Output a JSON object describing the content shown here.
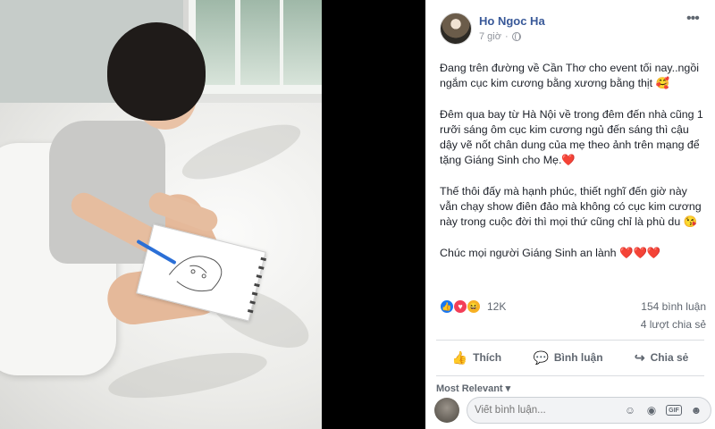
{
  "post": {
    "author": "Ho Ngoc Ha",
    "time": "7 giờ",
    "paragraphs": [
      "Đang trên đường về Cần Thơ cho event tối nay..ngồi ngắm cục kim cương bằng xương bằng thịt 🥰",
      "Đêm qua bay từ Hà Nội về trong đêm đến nhà cũng 1 rưỡi sáng ôm cục kim cương ngủ đến sáng thì cậu dậy vẽ nốt chân dung của mẹ theo ảnh trên mạng để tặng Giáng Sinh cho Mẹ.",
      "Thế thôi đấy mà hạnh phúc, thiết nghĩ đến giờ này vẫn chạy show điên đảo mà không có cục kim cương này trong cuộc đời thì mọi thứ cũng chỉ là phù du 😘",
      "Chúc mọi người Giáng Sinh an lành"
    ],
    "hearts_p2": "❤️",
    "hearts_p4": "❤️❤️❤️"
  },
  "stats": {
    "reaction_count": "12K",
    "comments": "154 bình luận",
    "shares": "4 lượt chia sẻ"
  },
  "actions": {
    "like": "Thích",
    "comment": "Bình luận",
    "share": "Chia sẻ"
  },
  "comments": {
    "sort_label": "Most Relevant ▾",
    "placeholder": "Viết bình luận...",
    "gif": "GIF"
  },
  "icons": {
    "more": "more-horizontal-icon",
    "privacy": "globe-icon",
    "like": "thumbs-up-icon",
    "comment": "speech-bubble-icon",
    "share": "share-arrow-icon",
    "emoji": "smiley-icon",
    "camera": "camera-icon",
    "sticker": "sticker-icon"
  },
  "colors": {
    "author_link": "#385898",
    "like_blue": "#1877f2",
    "love_red": "#f33e58",
    "haha_yellow": "#f7b125"
  }
}
